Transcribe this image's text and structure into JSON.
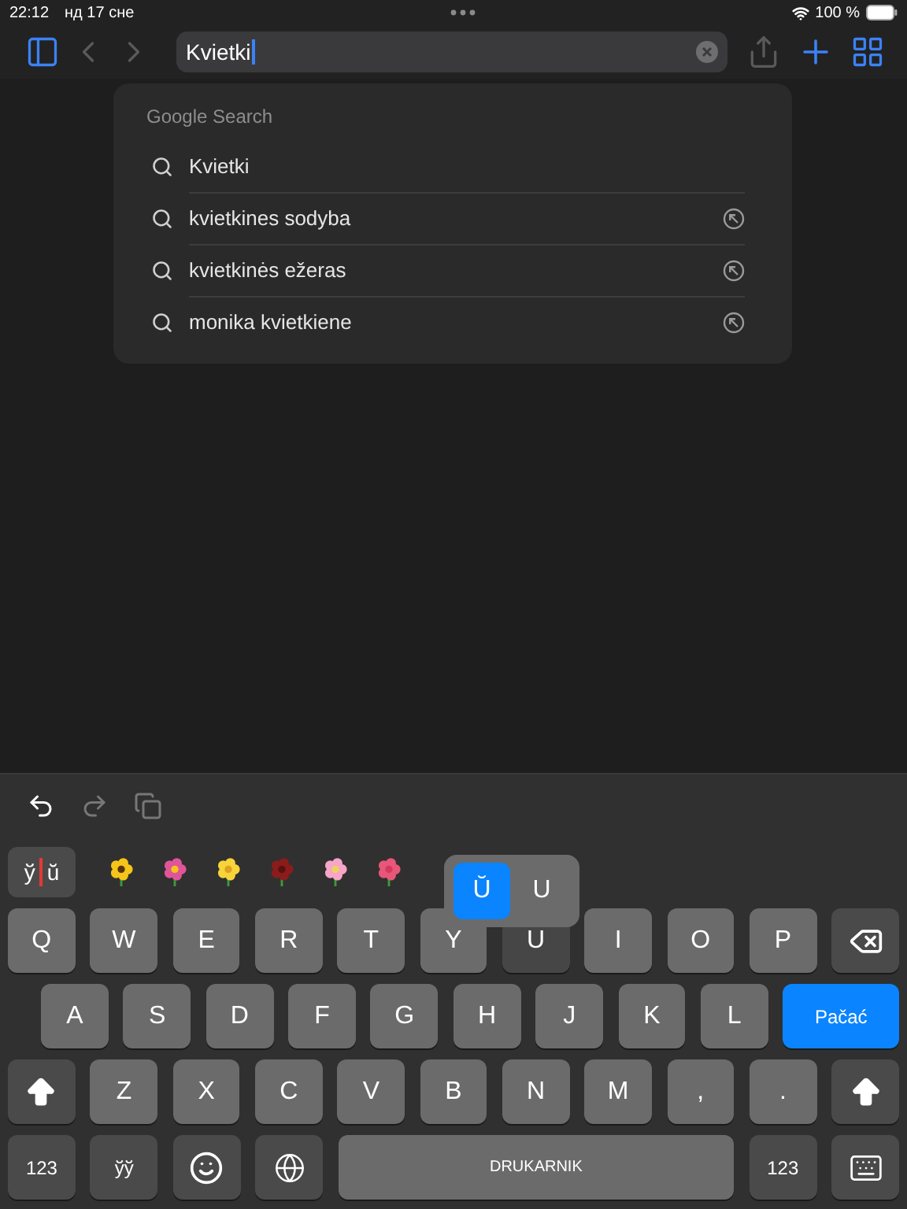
{
  "status_bar": {
    "time": "22:12",
    "date": "нд 17 сне",
    "battery": "100 %"
  },
  "toolbar": {
    "buttons": [
      {
        "kind": "sidebar",
        "disabled": false
      },
      {
        "kind": "back",
        "disabled": true
      },
      {
        "kind": "forward",
        "disabled": true
      }
    ],
    "search_field": {
      "value": "Kvietki"
    },
    "actions": [
      {
        "kind": "share",
        "disabled": true
      },
      {
        "kind": "new_tab",
        "disabled": false
      },
      {
        "kind": "tabs",
        "disabled": false
      }
    ]
  },
  "suggestions": {
    "header": "Google Search",
    "items": [
      {
        "text": "Kvietki",
        "kind": "query"
      },
      {
        "text": "kvietkines sodyba",
        "kind": "suggestion"
      },
      {
        "text": "kvietkinės ežeras",
        "kind": "suggestion"
      },
      {
        "text": "monika kvietkiene",
        "kind": "suggestion"
      }
    ]
  },
  "keyboard": {
    "shortcuts": [
      {
        "kind": "undo",
        "disabled": false
      },
      {
        "kind": "redo",
        "disabled": true
      },
      {
        "kind": "paste",
        "disabled": true
      }
    ],
    "candidate": {
      "left": "ў",
      "right": "ŭ"
    },
    "accent_popup": [
      {
        "label": "Ŭ",
        "selected": true
      },
      {
        "label": "U",
        "selected": false
      }
    ],
    "letter_row_1": [
      {
        "kind": "letter",
        "label": "Q"
      },
      {
        "kind": "letter",
        "label": "W"
      },
      {
        "kind": "letter",
        "label": "E"
      },
      {
        "kind": "letter",
        "label": "R"
      },
      {
        "kind": "letter",
        "label": "T"
      },
      {
        "kind": "letter",
        "label": "Y"
      },
      {
        "kind": "letter",
        "label": "U",
        "pressed": true
      },
      {
        "kind": "letter",
        "label": "I"
      },
      {
        "kind": "letter",
        "label": "O"
      },
      {
        "kind": "letter",
        "label": "P"
      },
      {
        "kind": "backspace"
      }
    ],
    "letter_row_2": [
      {
        "kind": "letter",
        "label": "A"
      },
      {
        "kind": "letter",
        "label": "S"
      },
      {
        "kind": "letter",
        "label": "D"
      },
      {
        "kind": "letter",
        "label": "F"
      },
      {
        "kind": "letter",
        "label": "G"
      },
      {
        "kind": "letter",
        "label": "H"
      },
      {
        "kind": "letter",
        "label": "J"
      },
      {
        "kind": "letter",
        "label": "K"
      },
      {
        "kind": "letter",
        "label": "L"
      },
      {
        "kind": "return",
        "label": "Pačać"
      }
    ],
    "letter_row_3": [
      {
        "kind": "shift"
      },
      {
        "kind": "letter",
        "label": "Z"
      },
      {
        "kind": "letter",
        "label": "X"
      },
      {
        "kind": "letter",
        "label": "C"
      },
      {
        "kind": "letter",
        "label": "V"
      },
      {
        "kind": "letter",
        "label": "B"
      },
      {
        "kind": "letter",
        "label": "N"
      },
      {
        "kind": "letter",
        "label": "M"
      },
      {
        "kind": "letter",
        "label": ","
      },
      {
        "kind": "letter",
        "label": "."
      },
      {
        "kind": "shift"
      }
    ],
    "bottom_row": [
      {
        "kind": "function",
        "label": "123"
      },
      {
        "kind": "function",
        "label": "ўў"
      },
      {
        "kind": "emoji"
      },
      {
        "kind": "globe"
      },
      {
        "kind": "space",
        "label": "DRUKARNIK"
      },
      {
        "kind": "function",
        "label": "123"
      },
      {
        "kind": "hide"
      }
    ]
  }
}
